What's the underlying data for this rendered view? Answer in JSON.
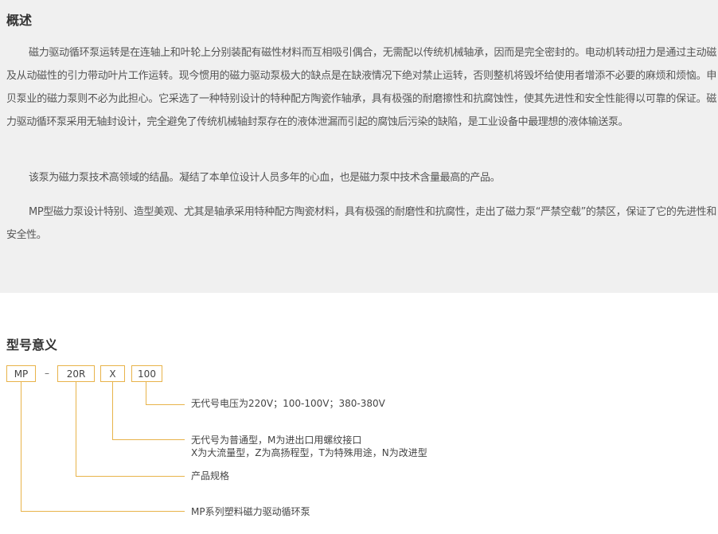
{
  "overview": {
    "title": "概述",
    "paragraphs": [
      "磁力驱动循环泵运转是在连轴上和叶轮上分别装配有磁性材料而互相吸引偶合，无需配以传统机械轴承，因而是完全密封的。电动机转动扭力是通过主动磁及从动磁性的引力带动叶片工作运转。现今惯用的磁力驱动泵极大的缺点是在缺液情况下绝对禁止运转，否则整机将毁坏给使用者增添不必要的麻烦和烦恼。申贝泵业的磁力泵则不必为此担心。它采选了一种特别设计的特种配方陶瓷作轴承，具有极强的耐磨擦性和抗腐蚀性，使其先进性和安全性能得以可靠的保证。磁力驱动循环泵采用无轴封设计，完全避免了传统机械轴封泵存在的液体泄漏而引起的腐蚀后污染的缺陷，是工业设备中最理想的液体输送泵。",
      "该泵为磁力泵技术高领域的结晶。凝结了本单位设计人员多年的心血，也是磁力泵中技术含量最高的产品。",
      "MP型磁力泵设计特别、造型美观、尤其是轴承采用特种配方陶瓷材料，具有极强的耐磨性和抗腐性，走出了磁力泵“严禁空载”的禁区，保证了它的先进性和安全性。"
    ]
  },
  "model": {
    "title": "型号意义",
    "codes": [
      "MP",
      "–",
      "20R",
      "X",
      "100"
    ],
    "labels": [
      "无代号电压为220V；100-100V；380-380V",
      "无代号为普通型，M为进出口用螺纹接口",
      "X为大流量型，Z为高扬程型，T为特殊用途，N为改进型",
      "产品规格",
      "MP系列塑料磁力驱动循环泵"
    ]
  },
  "colors": {
    "accent": "#e8b34a",
    "panel_bg": "#f0f0f0"
  }
}
